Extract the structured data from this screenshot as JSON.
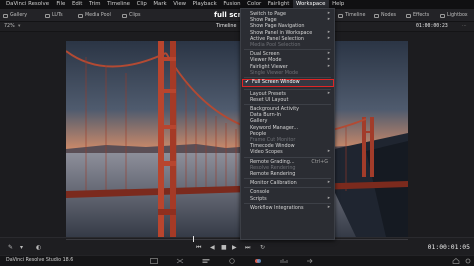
{
  "menubar": {
    "app": "DaVinci Resolve",
    "items": [
      "File",
      "Edit",
      "Trim",
      "Timeline",
      "Clip",
      "Mark",
      "View",
      "Playback",
      "Fusion",
      "Color",
      "Fairlight",
      "Workspace",
      "Help"
    ]
  },
  "toolbar": {
    "left": [
      {
        "label": "Gallery",
        "icon": "gallery-icon"
      },
      {
        "label": "LUTs",
        "icon": "luts-icon"
      },
      {
        "label": "Media Pool",
        "icon": "media-pool-icon"
      },
      {
        "label": "Clips",
        "icon": "clips-icon"
      }
    ],
    "title": "full screen",
    "right": [
      {
        "label": "Timeline",
        "icon": "timeline-icon"
      },
      {
        "label": "Nodes",
        "icon": "nodes-icon"
      },
      {
        "label": "Effects",
        "icon": "effects-icon"
      },
      {
        "label": "Lightbox",
        "icon": "lightbox-icon"
      }
    ]
  },
  "viewerbar": {
    "zoom": "72%",
    "clip_name": "Timeline",
    "timecode": "01:00:00:23"
  },
  "workspace_menu": {
    "items": [
      {
        "label": "Switch to Page",
        "submenu": true
      },
      {
        "label": "Show Page",
        "submenu": true
      },
      {
        "label": "Show Page Navigation"
      },
      {
        "label": "Show Panel in Workspace",
        "submenu": true
      },
      {
        "label": "Active Panel Selection",
        "submenu": true
      },
      {
        "label": "Media Pool Selection",
        "disabled": true
      },
      {
        "sep": true
      },
      {
        "label": "Dual Screen",
        "submenu": true
      },
      {
        "label": "Viewer Mode",
        "submenu": true
      },
      {
        "label": "Fairlight Viewer",
        "submenu": true
      },
      {
        "label": "Single Viewer Mode",
        "disabled": true
      },
      {
        "sep": true
      },
      {
        "label": "Full Screen Window",
        "checked": true,
        "highlight": true
      },
      {
        "sep": true
      },
      {
        "label": "Layout Presets",
        "submenu": true
      },
      {
        "label": "Reset UI Layout"
      },
      {
        "sep": true
      },
      {
        "label": "Background Activity"
      },
      {
        "label": "Data Burn-In"
      },
      {
        "label": "Gallery"
      },
      {
        "label": "Keyword Manager..."
      },
      {
        "label": "People"
      },
      {
        "label": "Frame Cut Monitor",
        "disabled": true
      },
      {
        "label": "Timecode Window"
      },
      {
        "label": "Video Scopes",
        "submenu": true
      },
      {
        "sep": true
      },
      {
        "label": "Remote Grading...",
        "shortcut": "Ctrl+G"
      },
      {
        "label": "Resolve Rendering",
        "disabled": true
      },
      {
        "label": "Remote Rendering"
      },
      {
        "sep": true
      },
      {
        "label": "Monitor Calibration",
        "submenu": true
      },
      {
        "sep": true
      },
      {
        "label": "Console"
      },
      {
        "label": "Scripts",
        "submenu": true
      },
      {
        "sep": true
      },
      {
        "label": "Workflow Integrations",
        "submenu": true
      }
    ]
  },
  "transport": {
    "timecode": "01:00:01:05"
  },
  "statusbar": {
    "brand": "DaVinci Resolve Studio 18.6"
  }
}
